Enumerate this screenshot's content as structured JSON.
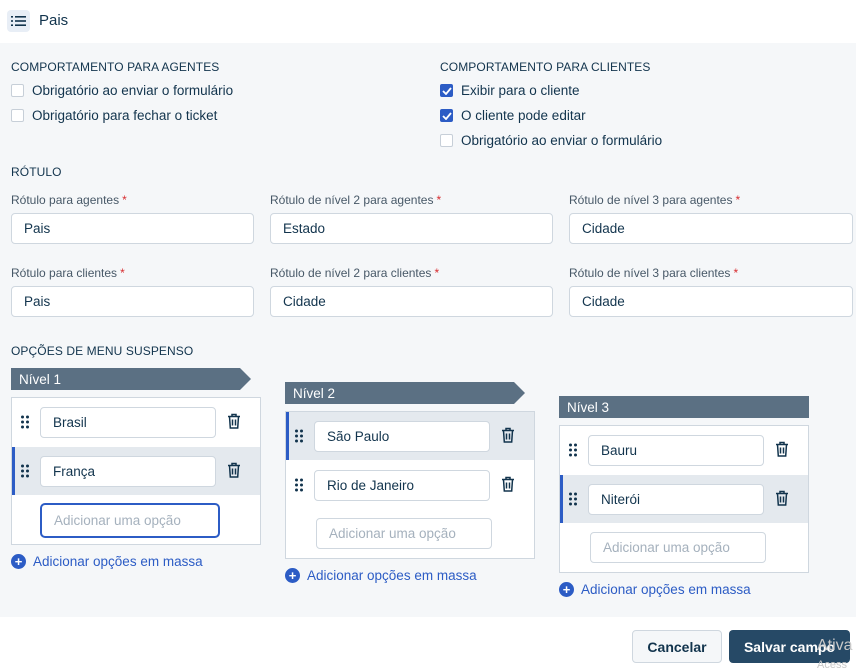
{
  "header": {
    "title": "Pais",
    "icon": "list-menu-icon"
  },
  "agents_behavior": {
    "heading": "COMPORTAMENTO PARA AGENTES",
    "options": [
      {
        "label": "Obrigatório ao enviar o formulário",
        "checked": false
      },
      {
        "label": "Obrigatório para fechar o ticket",
        "checked": false
      }
    ]
  },
  "clients_behavior": {
    "heading": "COMPORTAMENTO PARA CLIENTES",
    "options": [
      {
        "label": "Exibir para o cliente",
        "checked": true
      },
      {
        "label": "O cliente pode editar",
        "checked": true
      },
      {
        "label": "Obrigatório ao enviar o formulário",
        "checked": false
      }
    ]
  },
  "labels": {
    "heading": "RÓTULO",
    "agents": [
      {
        "label": "Rótulo para agentes",
        "value": "Pais"
      },
      {
        "label": "Rótulo de nível 2 para agentes",
        "value": "Estado"
      },
      {
        "label": "Rótulo de nível 3 para agentes",
        "value": "Cidade"
      }
    ],
    "clients": [
      {
        "label": "Rótulo para clientes",
        "value": "Pais"
      },
      {
        "label": "Rótulo de nível 2 para clientes",
        "value": "Cidade"
      },
      {
        "label": "Rótulo de nível 3 para clientes",
        "value": "Cidade"
      }
    ],
    "required_mark": "*"
  },
  "dropdown": {
    "heading": "OPÇÕES DE MENU SUSPENSO",
    "add_placeholder": "Adicionar uma opção",
    "bulk_label": "Adicionar opções em massa",
    "levels": [
      {
        "title": "Nível 1",
        "options": [
          "Brasil",
          "França"
        ],
        "selected": 1
      },
      {
        "title": "Nível 2",
        "options": [
          "São Paulo",
          "Rio de Janeiro"
        ],
        "selected": 0
      },
      {
        "title": "Nível 3",
        "options": [
          "Bauru",
          "Niterói"
        ],
        "selected": 1
      }
    ]
  },
  "footer": {
    "cancel_label": "Cancelar",
    "save_label": "Salvar campo",
    "watermark_line1": "Ativa",
    "watermark_line2": "Acess"
  },
  "colors": {
    "accent": "#2c5cc5",
    "primary_button": "#264966",
    "level_tag": "#5b7083",
    "required": "#d72d30"
  }
}
